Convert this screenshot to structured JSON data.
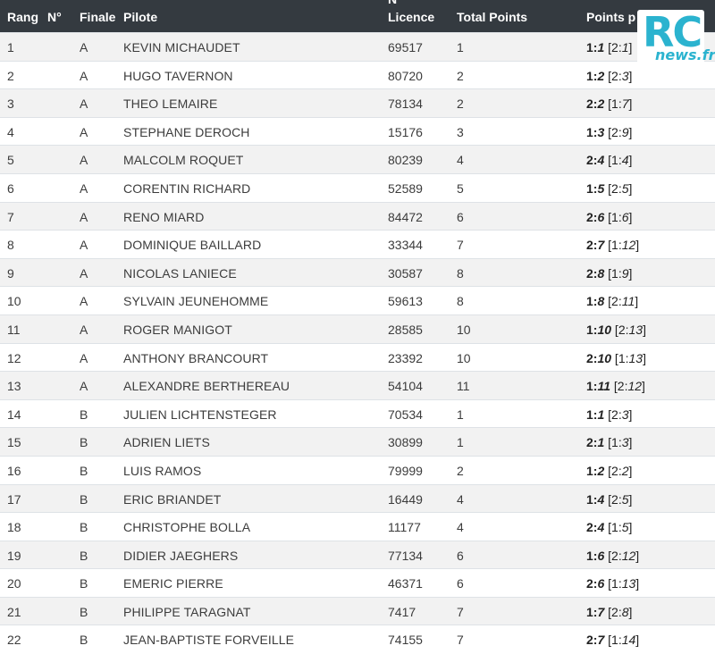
{
  "header": {
    "rang": "Rang",
    "no": "N°",
    "finale": "Finale",
    "pilote": "Pilote",
    "licence_no": "N°",
    "licence": "Licence",
    "total": "Total Points",
    "points": "Points p"
  },
  "logo": {
    "rc": "RC",
    "news": "news.fr"
  },
  "rows": [
    {
      "rang": "1",
      "finale": "A",
      "pilote": "KEVIN MICHAUDET",
      "licence": "69517",
      "total": "1",
      "p1": "1:",
      "p1i": "1",
      "p2": "2:",
      "p2i": "1"
    },
    {
      "rang": "2",
      "finale": "A",
      "pilote": "HUGO TAVERNON",
      "licence": "80720",
      "total": "2",
      "p1": "1:",
      "p1i": "2",
      "p2": "2:",
      "p2i": "3"
    },
    {
      "rang": "3",
      "finale": "A",
      "pilote": "THEO LEMAIRE",
      "licence": "78134",
      "total": "2",
      "p1": "2:",
      "p1i": "2",
      "p2": "1:",
      "p2i": "7"
    },
    {
      "rang": "4",
      "finale": "A",
      "pilote": "STEPHANE DEROCH",
      "licence": "15176",
      "total": "3",
      "p1": "1:",
      "p1i": "3",
      "p2": "2:",
      "p2i": "9"
    },
    {
      "rang": "5",
      "finale": "A",
      "pilote": "MALCOLM ROQUET",
      "licence": "80239",
      "total": "4",
      "p1": "2:",
      "p1i": "4",
      "p2": "1:",
      "p2i": "4"
    },
    {
      "rang": "6",
      "finale": "A",
      "pilote": "CORENTIN RICHARD",
      "licence": "52589",
      "total": "5",
      "p1": "1:",
      "p1i": "5",
      "p2": "2:",
      "p2i": "5"
    },
    {
      "rang": "7",
      "finale": "A",
      "pilote": "RENO MIARD",
      "licence": "84472",
      "total": "6",
      "p1": "2:",
      "p1i": "6",
      "p2": "1:",
      "p2i": "6"
    },
    {
      "rang": "8",
      "finale": "A",
      "pilote": "DOMINIQUE BAILLARD",
      "licence": "33344",
      "total": "7",
      "p1": "2:",
      "p1i": "7",
      "p2": "1:",
      "p2i": "12"
    },
    {
      "rang": "9",
      "finale": "A",
      "pilote": "NICOLAS LANIECE",
      "licence": "30587",
      "total": "8",
      "p1": "2:",
      "p1i": "8",
      "p2": "1:",
      "p2i": "9"
    },
    {
      "rang": "10",
      "finale": "A",
      "pilote": "SYLVAIN JEUNEHOMME",
      "licence": "59613",
      "total": "8",
      "p1": "1:",
      "p1i": "8",
      "p2": "2:",
      "p2i": "11"
    },
    {
      "rang": "11",
      "finale": "A",
      "pilote": "ROGER MANIGOT",
      "licence": "28585",
      "total": "10",
      "p1": "1:",
      "p1i": "10",
      "p2": "2:",
      "p2i": "13"
    },
    {
      "rang": "12",
      "finale": "A",
      "pilote": "ANTHONY BRANCOURT",
      "licence": "23392",
      "total": "10",
      "p1": "2:",
      "p1i": "10",
      "p2": "1:",
      "p2i": "13"
    },
    {
      "rang": "13",
      "finale": "A",
      "pilote": "ALEXANDRE BERTHEREAU",
      "licence": "54104",
      "total": "11",
      "p1": "1:",
      "p1i": "11",
      "p2": "2:",
      "p2i": "12"
    },
    {
      "rang": "14",
      "finale": "B",
      "pilote": "JULIEN LICHTENSTEGER",
      "licence": "70534",
      "total": "1",
      "p1": "1:",
      "p1i": "1",
      "p2": "2:",
      "p2i": "3"
    },
    {
      "rang": "15",
      "finale": "B",
      "pilote": "ADRIEN LIETS",
      "licence": "30899",
      "total": "1",
      "p1": "2:",
      "p1i": "1",
      "p2": "1:",
      "p2i": "3"
    },
    {
      "rang": "16",
      "finale": "B",
      "pilote": "LUIS RAMOS",
      "licence": "79999",
      "total": "2",
      "p1": "1:",
      "p1i": "2",
      "p2": "2:",
      "p2i": "2"
    },
    {
      "rang": "17",
      "finale": "B",
      "pilote": "ERIC BRIANDET",
      "licence": "16449",
      "total": "4",
      "p1": "1:",
      "p1i": "4",
      "p2": "2:",
      "p2i": "5"
    },
    {
      "rang": "18",
      "finale": "B",
      "pilote": "CHRISTOPHE BOLLA",
      "licence": "11177",
      "total": "4",
      "p1": "2:",
      "p1i": "4",
      "p2": "1:",
      "p2i": "5"
    },
    {
      "rang": "19",
      "finale": "B",
      "pilote": "DIDIER JAEGHERS",
      "licence": "77134",
      "total": "6",
      "p1": "1:",
      "p1i": "6",
      "p2": "2:",
      "p2i": "12"
    },
    {
      "rang": "20",
      "finale": "B",
      "pilote": "EMERIC PIERRE",
      "licence": "46371",
      "total": "6",
      "p1": "2:",
      "p1i": "6",
      "p2": "1:",
      "p2i": "13"
    },
    {
      "rang": "21",
      "finale": "B",
      "pilote": "PHILIPPE TARAGNAT",
      "licence": "7417",
      "total": "7",
      "p1": "1:",
      "p1i": "7",
      "p2": "2:",
      "p2i": "8"
    },
    {
      "rang": "22",
      "finale": "B",
      "pilote": "JEAN-BAPTISTE FORVEILLE",
      "licence": "74155",
      "total": "7",
      "p1": "2:",
      "p1i": "7",
      "p2": "1:",
      "p2i": "14"
    }
  ]
}
